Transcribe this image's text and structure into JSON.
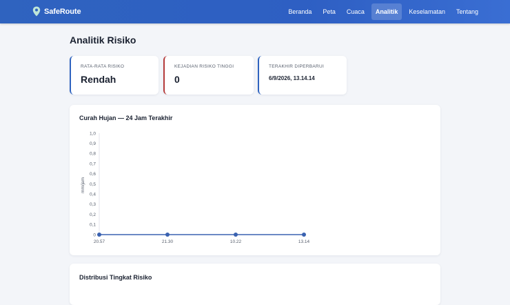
{
  "navbar": {
    "brand": "SafeRoute",
    "brand_icon": "map-pin-icon",
    "items": [
      {
        "label": "Beranda"
      },
      {
        "label": "Peta"
      },
      {
        "label": "Cuaca"
      },
      {
        "label": "Analitik",
        "active": true
      },
      {
        "label": "Keselamatan"
      },
      {
        "label": "Tentang"
      }
    ]
  },
  "page": {
    "title": "Analitik Risiko"
  },
  "cards": [
    {
      "label": "RATA-RATA RISIKO",
      "value": "Rendah",
      "accent": "#2f63bf"
    },
    {
      "label": "KEJADIAN RISIKO TINGGI",
      "value": "0",
      "accent": "#b53a3a"
    },
    {
      "label": "TERAKHIR DIPERBARUI",
      "value": "6/9/2026, 13.14.14",
      "accent": "#2f63bf"
    }
  ],
  "chart": {
    "title": "Curah Hujan — 24 Jam Terakhir"
  },
  "distribution": {
    "title": "Distribusi Tingkat Risiko"
  },
  "chart_data": {
    "type": "line",
    "title": "Curah Hujan — 24 Jam Terakhir",
    "xlabel": "",
    "ylabel": "mm/jam",
    "x": [
      "20.57",
      "21.30",
      "10.22",
      "13.14"
    ],
    "series": [
      {
        "values": [
          0,
          0,
          0,
          0
        ],
        "color": "#3a62b0"
      }
    ],
    "ylim": [
      0,
      1.0
    ],
    "yticks": [
      "0",
      "0,1",
      "0,2",
      "0,3",
      "0,4",
      "0,5",
      "0,6",
      "0,7",
      "0,8",
      "0,9",
      "1,0"
    ],
    "grid": false,
    "legend": "none"
  }
}
